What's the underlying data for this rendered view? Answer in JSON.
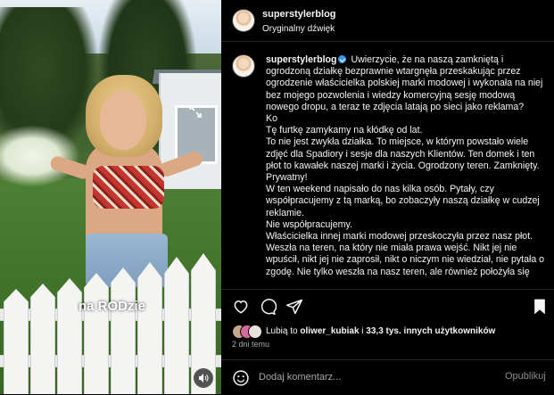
{
  "media": {
    "caption_overlay": "na RODzie",
    "expand_icon": "collapse-arrow-icon",
    "mute_icon": "speaker-icon"
  },
  "header": {
    "username": "superstylerblog",
    "audio": "Oryginalny dźwięk",
    "more_icon": "more-options-icon"
  },
  "caption": {
    "username": "superstylerblog",
    "lines": [
      "Uwierzycie, że na naszą zamkniętą i ogrodzoną działkę bezprawnie wtargnęła przeskakując przez ogrodzenie właścicielka polskiej marki modowej i wykonała na niej bez mojego pozwolenia i wiedzy komercyjną sesję modową nowego dropu, a teraz te zdjęcia latają po sieci jako reklama?",
      "Ko",
      "Tę furtkę zamykamy na kłódkę od lat.",
      "To nie jest zwykła działka. To miejsce, w którym powstało wiele zdjęć dla Spadiory i sesje dla naszych Klientów. Ten domek i ten płot to kawałek naszej marki i życia. Ogrodzony teren. Zamknięty. Prywatny!",
      "W ten weekend napisało do nas kilka osób. Pytały, czy współpracujemy z tą marką, bo zobaczyły naszą działkę w cudzej reklamie.",
      "Nie współpracujemy.",
      "Właścicielka innej marki modowej przeskoczyła przez nasz płot. Weszła na teren, na który nie miała prawa wejść. Nikt jej nie wpuścił, nikt jej nie zaprosił, nikt o niczym nie wiedział, nie pytała o zgodę. Nie tylko weszła na nasz teren, ale również położyła się"
    ]
  },
  "actions": {
    "like_icon": "heart-icon",
    "comment_icon": "comment-icon",
    "share_icon": "send-icon",
    "save_icon": "bookmark-icon"
  },
  "likes": {
    "prefix": "Lubią to ",
    "user": "oliwer_kubiak",
    "middle": " i ",
    "count": "33,3 tys. innych użytkowników"
  },
  "timestamp": "2 dni temu",
  "comment": {
    "placeholder": "Dodaj komentarz...",
    "post_label": "Opublikuj"
  },
  "colors": {
    "background": "#000000",
    "text": "#f5f5f5",
    "muted": "#a8a8a8",
    "verified": "#3897f0",
    "divider": "#262626"
  }
}
